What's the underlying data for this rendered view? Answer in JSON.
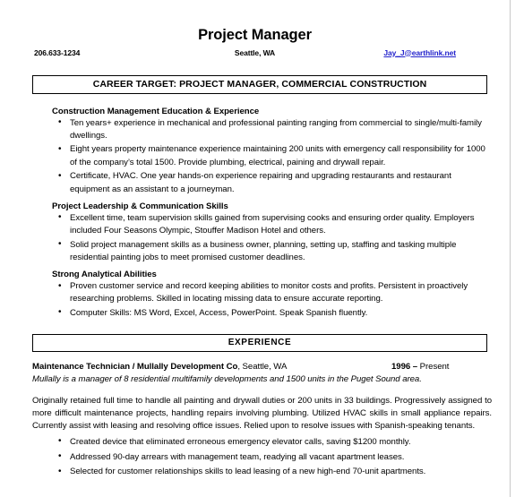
{
  "document": {
    "title": "Project Manager",
    "contact": {
      "phone": "206.633-1234",
      "location": "Seattle, WA",
      "email": "Jay_J@earthlink.net",
      "email_color": "#2222cc"
    },
    "career_target_banner": "CAREER TARGET:  PROJECT MANAGER, COMMERCIAL CONSTRUCTION",
    "experience_banner": "EXPERIENCE",
    "sections": [
      {
        "heading": "Construction Management Education & Experience",
        "bullets": [
          "Ten years+ experience in mechanical and professional painting ranging from commercial  to single/multi-family dwellings.",
          "Eight years property maintenance experience maintaining 200 units with emergency call responsibility for 1000 of the company’s total 1500. Provide plumbing, electrical, paining and drywall repair.",
          "Certificate, HVAC.  One year hands-on experience repairing and upgrading restaurants and restaurant equipment as an assistant to a journeyman."
        ]
      },
      {
        "heading": "Project Leadership & Communication Skills",
        "bullets": [
          "Excellent time, team supervision skills gained from supervising cooks and ensuring order quality. Employers included Four Seasons Olympic, Stouffer Madison Hotel and others.",
          "Solid project management skills as a business owner, planning, setting up, staffing and tasking multiple residential painting jobs to meet promised customer deadlines."
        ]
      },
      {
        "heading": "Strong Analytical Abilities",
        "bullets": [
          "Proven customer service and record keeping abilities to monitor costs and profits. Persistent in proactively researching problems.  Skilled in locating missing data to ensure accurate reporting.",
          "Computer Skills: MS Word, Excel, Access, PowerPoint. Speak Spanish fluently."
        ]
      }
    ],
    "experience": [
      {
        "title": "Maintenance Technician / Mullally Development Co",
        "location": ", Seattle, WA",
        "date_start": "1996 –",
        "date_end": " Present",
        "tagline": "Mullally is a manager of 8 residential multifamily developments and 1500 units in the Puget Sound area.",
        "paragraph": "Originally retained full time to handle all painting and drywall duties or 200 units in 33 buildings. Progressively assigned to more difficult maintenance projects, handling repairs involving plumbing.  Utilized HVAC skills in small appliance repairs. Currently assist with leasing and resolving office issues.  Relied upon to resolve issues with Spanish-speaking tenants.",
        "bullets": [
          "Created device that eliminated erroneous emergency elevator calls, saving $1200 monthly.",
          "Addressed 90-day arrears with management team, readying all vacant apartment leases.",
          "Selected for customer relationships skills to lead leasing of a new high-end 70-unit apartments."
        ]
      }
    ]
  }
}
